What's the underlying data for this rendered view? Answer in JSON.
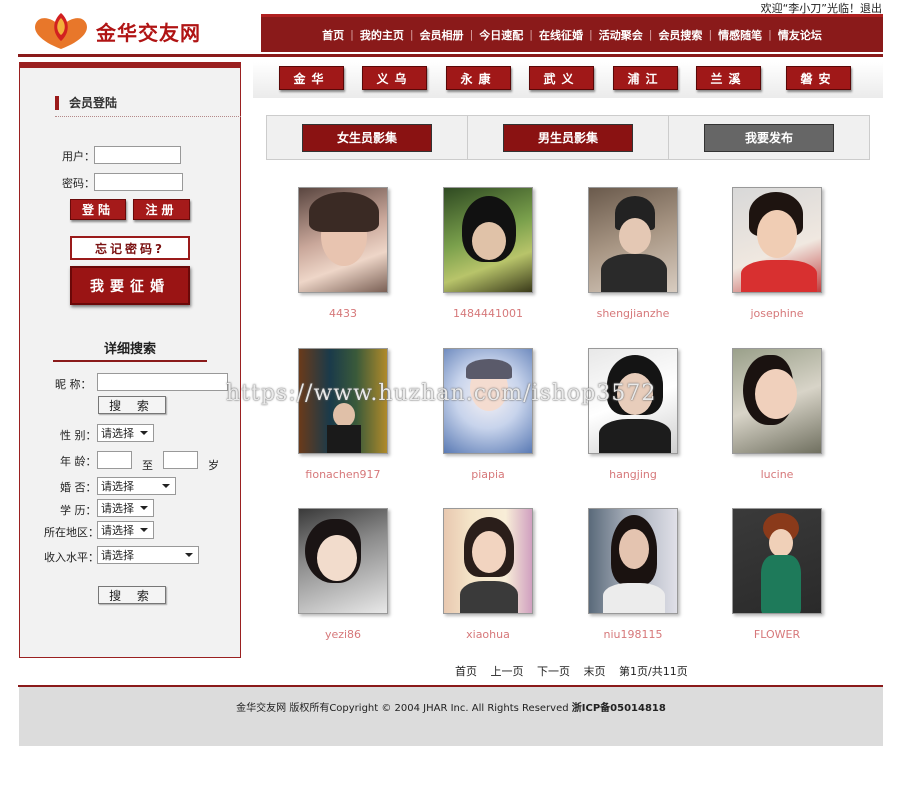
{
  "header": {
    "welcome": "欢迎“李小刀”光临！退出",
    "logo_text": "金华交友网",
    "nav": [
      "首页",
      "我的主页",
      "会员相册",
      "今日速配",
      "在线征婚",
      "活动聚会",
      "会员搜索",
      "情感随笔",
      "情友论坛"
    ]
  },
  "sidebar": {
    "login_title": "会员登陆",
    "user_label": "用户：",
    "password_label": "密码：",
    "login_button": "登陆",
    "register_button": "注册",
    "forgot_button": "忘记密码?",
    "marry_button": "我要征婚",
    "detail_search_title": "详细搜索",
    "nickname_label": "昵  称：",
    "search_button": "搜 索",
    "gender_label": "性  别：",
    "gender_value": "请选择",
    "age_label": "年  龄：",
    "age_to": "至",
    "age_unit": "岁",
    "marital_label": "婚  否：",
    "marital_value": "请选择",
    "education_label": "学  历：",
    "education_value": "请选择",
    "region_label": "所在地区：",
    "region_value": "请选择",
    "income_label": "收入水平：",
    "income_value": "请选择",
    "search_button_2": "搜 索"
  },
  "cities": [
    "金华",
    "义乌",
    "永康",
    "武义",
    "浦江",
    "兰溪",
    "磐安"
  ],
  "tabs": [
    {
      "label": "女生员影集",
      "color": "#8a1212"
    },
    {
      "label": "男生员影集",
      "color": "#8a1212"
    },
    {
      "label": "我要发布",
      "color": "#666666"
    }
  ],
  "members": [
    {
      "name": "4433"
    },
    {
      "name": "1484441001"
    },
    {
      "name": "shengjianzhe"
    },
    {
      "name": "josephine"
    },
    {
      "name": "fionachen917"
    },
    {
      "name": "piapia"
    },
    {
      "name": "hangjing"
    },
    {
      "name": "lucine"
    },
    {
      "name": "yezi86"
    },
    {
      "name": "xiaohua"
    },
    {
      "name": "niu198115"
    },
    {
      "name": "FLOWER"
    }
  ],
  "pager": {
    "first": "首页",
    "prev": "上一页",
    "next": "下一页",
    "last": "末页",
    "info": "第1页/共11页"
  },
  "footer": {
    "copyright": "金华交友网 版权所有Copyright © 2004 JHAR Inc. All Rights Reserved",
    "icp": "浙ICP备05014818"
  },
  "watermark": "https://www.huzhan.com/ishop3572"
}
